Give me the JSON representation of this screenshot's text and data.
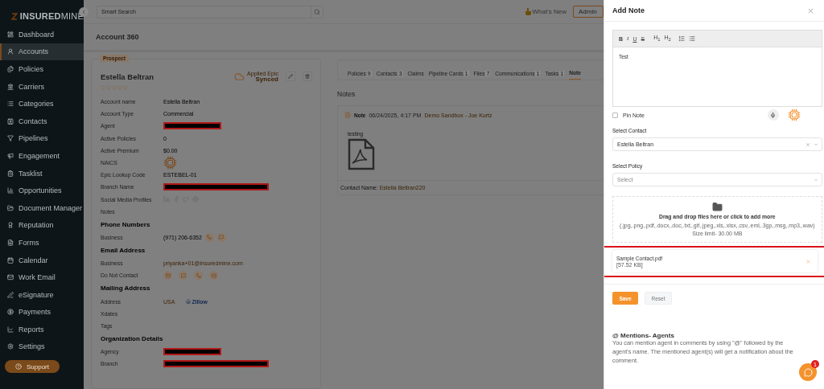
{
  "sidebar": {
    "logo": "**INSURED**MINE",
    "items": [
      {
        "label": "Dashboard",
        "selected": false
      },
      {
        "label": "Accounts",
        "selected": true
      },
      {
        "label": "Policies",
        "selected": false
      },
      {
        "label": "Carriers",
        "selected": false
      },
      {
        "label": "Categories",
        "selected": false
      },
      {
        "label": "Contacts",
        "selected": false
      },
      {
        "label": "Pipelines",
        "selected": false
      },
      {
        "label": "Engagement",
        "selected": false
      },
      {
        "label": "Tasklist",
        "selected": false
      },
      {
        "label": "Opportunities",
        "selected": false
      },
      {
        "label": "Document Manager",
        "selected": false
      },
      {
        "label": "Reputation",
        "selected": false
      },
      {
        "label": "Forms",
        "selected": false
      },
      {
        "label": "Calendar",
        "selected": false
      },
      {
        "label": "Work Email",
        "selected": false
      },
      {
        "label": "eSignature",
        "selected": false
      },
      {
        "label": "Payments",
        "selected": false
      },
      {
        "label": "Reports",
        "selected": false
      },
      {
        "label": "Settings",
        "selected": false
      }
    ],
    "support": "Support"
  },
  "topbar": {
    "search_placeholder": "Smart Search",
    "whats_new": "What's New",
    "user": "Admin"
  },
  "page_title": "Account 360",
  "account": {
    "badge": "Prospect",
    "name": "Estella Beltran",
    "sync_label": "Applied Epic",
    "sync_status": "Synced",
    "stars": 0,
    "fields": [
      {
        "label": "Account name",
        "kind": "text",
        "value": "Estella Beltran"
      },
      {
        "label": "Account Type",
        "kind": "text",
        "value": "Commercial"
      },
      {
        "label": "Agent",
        "kind": "masked"
      },
      {
        "label": "Active Policies",
        "kind": "text",
        "value": "0"
      },
      {
        "label": "Active Premium",
        "kind": "text",
        "value": "$0.00"
      },
      {
        "label": "NAICS",
        "kind": "ai"
      },
      {
        "label": "Epic Lookup Code",
        "kind": "text",
        "value": "ESTEBEL-01"
      },
      {
        "label": "Branch Name",
        "kind": "redacted"
      },
      {
        "label": "Social Media Profiles",
        "kind": "social"
      },
      {
        "label": "Notes",
        "kind": "empty"
      }
    ],
    "sections": [
      {
        "heading": "Phone Numbers",
        "fields": [
          {
            "label": "Business",
            "kind": "phone",
            "value": "(971) 206-6352"
          }
        ]
      },
      {
        "heading": "Email Address",
        "fields": [
          {
            "label": "Business",
            "kind": "link",
            "value": "priyanka+01@insuredmine.com"
          },
          {
            "label": "Do Not Contact",
            "kind": "contact"
          }
        ]
      },
      {
        "heading": "Mailing Address",
        "fields": [
          {
            "label": "Address",
            "kind": "address",
            "value": "USA",
            "extra": "Zillow"
          },
          {
            "label": "Xdates",
            "kind": "empty"
          },
          {
            "label": "Tags",
            "kind": "empty"
          }
        ]
      },
      {
        "heading": "Organization Details",
        "fields": [
          {
            "label": "Agency",
            "kind": "masked"
          },
          {
            "label": "Branch",
            "kind": "redacted"
          }
        ]
      }
    ]
  },
  "tabs": [
    {
      "label": "Policies",
      "count": "9",
      "selected": false
    },
    {
      "label": "Contacts",
      "count": "3",
      "selected": false
    },
    {
      "label": "Claims",
      "selected": false
    },
    {
      "label": "Pipeline Cards",
      "count": "1",
      "selected": false
    },
    {
      "label": "Files",
      "count": "7",
      "selected": false
    },
    {
      "label": "Communications",
      "count": "1",
      "selected": false
    },
    {
      "label": "Tasks",
      "count": "1",
      "selected": false
    },
    {
      "label": "Note",
      "selected": true
    }
  ],
  "notes": {
    "heading": "Notes",
    "items": [
      {
        "title": "Note",
        "date": "06/24/2025, 4:17 PM",
        "author": "Demo Sandbox - Joe Kurtz",
        "body": "testing",
        "contact_label": "Contact Name:",
        "contact": "Estella Beltran220"
      }
    ]
  },
  "drawer": {
    "title": "Add Note",
    "toolbar": [
      {
        "label": "B",
        "kind": "bold"
      },
      {
        "label": "I",
        "kind": "italic"
      },
      {
        "label": "U",
        "kind": "underline"
      },
      {
        "label": "S",
        "kind": "strike"
      },
      {
        "label": "H$_{1}$",
        "kind": "heading"
      },
      {
        "label": "H$_{2}$",
        "kind": "heading"
      },
      {
        "kind": "ordered"
      },
      {
        "kind": "bullet"
      }
    ],
    "body": "Test",
    "pin": {
      "label": "Pin Note",
      "checked": false
    },
    "contact": {
      "label": "Select Contact",
      "value": "Estella Beltran"
    },
    "policy": {
      "label": "Select Policy",
      "placeholder": "Select"
    },
    "dropzone": {
      "title": "Drag and drop files here or click to add more",
      "hint": "(.jpg,.png,.pdf,.docx,.doc,.txt,.gif,.jpeg,.xls,.xlsx,.csv,.eml,.3gp,.msg,.mp3,.wav) Size limit- 30.00 MB"
    },
    "attachment": {
      "name": "Sample Contact.pdf",
      "size": "[57.52 KB]"
    },
    "save": "Save",
    "reset": "Reset",
    "mentions": {
      "title": "@ Mentions- Agents",
      "body": "You can mention agent in comments by using \"@\" followed by the agent's name. The mentioned agent(s) will get a notification about the comment."
    },
    "chat": {
      "badge": "1"
    }
  }
}
